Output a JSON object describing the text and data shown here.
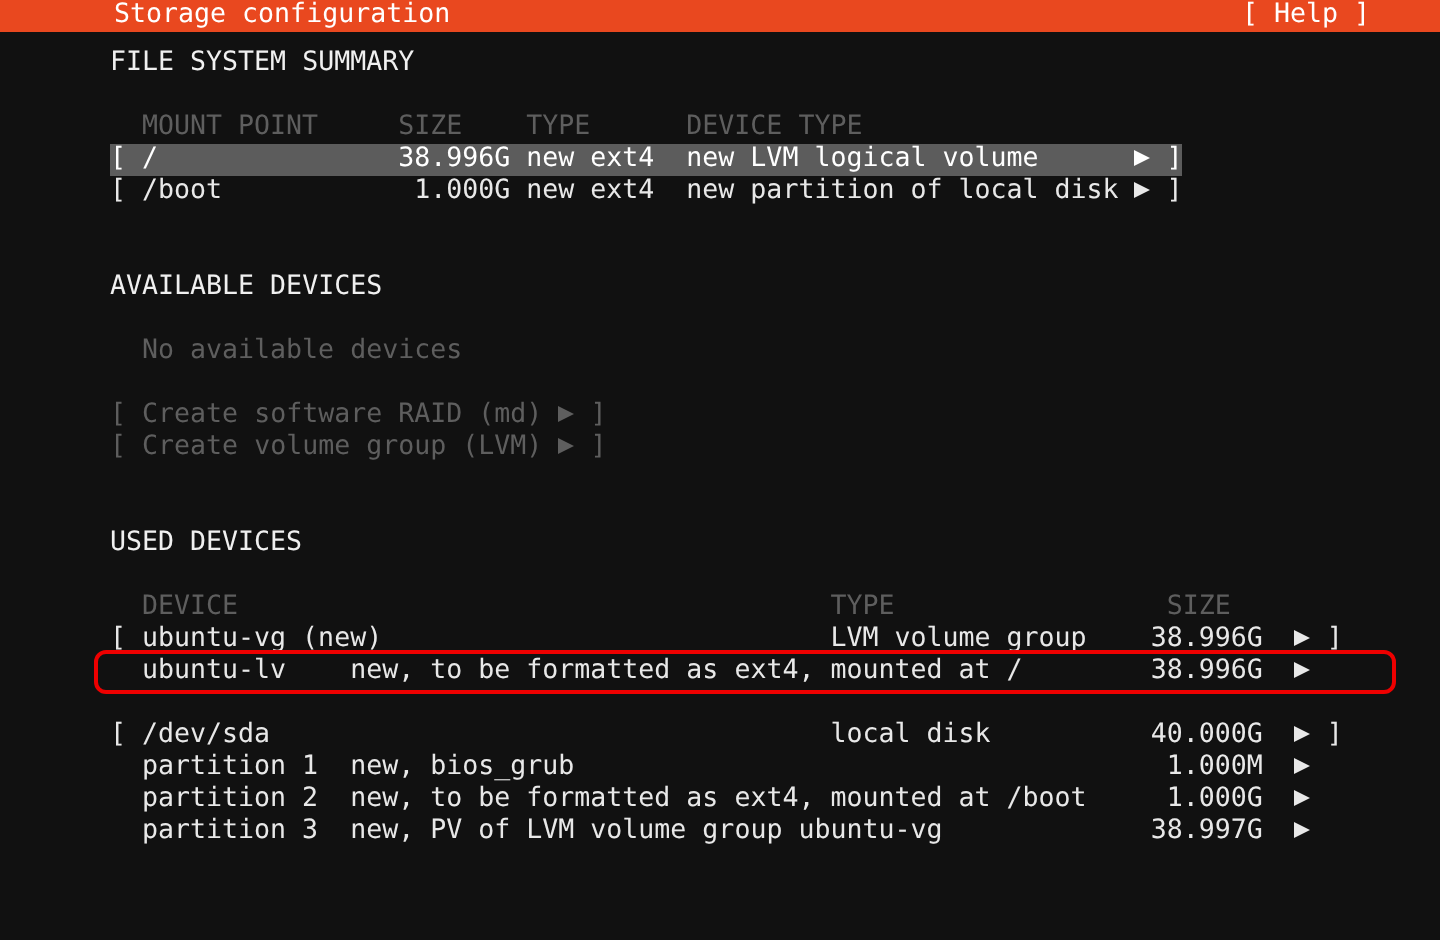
{
  "header": {
    "title": "Storage configuration",
    "help": "[ Help ]"
  },
  "file_system_summary": {
    "heading": "FILE SYSTEM SUMMARY",
    "columns": [
      "MOUNT POINT",
      "SIZE",
      "TYPE",
      "DEVICE TYPE"
    ],
    "rows": [
      {
        "open": "[",
        "mount": "/",
        "size": "38.996G",
        "type": "new ext4",
        "device_type": "new LVM logical volume",
        "close": "]",
        "selected": true
      },
      {
        "open": "[",
        "mount": "/boot",
        "size": "1.000G",
        "type": "new ext4",
        "device_type": "new partition of local disk",
        "close": "]",
        "selected": false
      }
    ]
  },
  "available_devices": {
    "heading": "AVAILABLE DEVICES",
    "note": "No available devices",
    "actions": [
      {
        "open": "[",
        "label": "Create software RAID (md)",
        "close": "]",
        "disabled": true
      },
      {
        "open": "[",
        "label": "Create volume group (LVM)",
        "close": "]",
        "disabled": true
      }
    ]
  },
  "used_devices": {
    "heading": "USED DEVICES",
    "columns": [
      "DEVICE",
      "TYPE",
      "SIZE"
    ],
    "groups": [
      {
        "rows": [
          {
            "open": "[",
            "name": "ubuntu-vg (new)",
            "type": "LVM volume group",
            "size": "38.996G",
            "close": "]",
            "highlighted": false
          },
          {
            "name": "ubuntu-lv",
            "description": "new, to be formatted as ext4, mounted at /",
            "size": "38.996G",
            "highlighted": true
          }
        ]
      },
      {
        "rows": [
          {
            "open": "[",
            "name": "/dev/sda",
            "type": "local disk",
            "size": "40.000G",
            "close": "]",
            "highlighted": false
          },
          {
            "name": "partition 1",
            "description": "new, bios_grub",
            "size": "1.000M",
            "highlighted": false
          },
          {
            "name": "partition 2",
            "description": "new, to be formatted as ext4, mounted at /boot",
            "size": "1.000G",
            "highlighted": false
          },
          {
            "name": "partition 3",
            "description": "new, PV of LVM volume group ubuntu-vg",
            "size": "38.997G",
            "highlighted": false
          }
        ]
      }
    ]
  }
}
